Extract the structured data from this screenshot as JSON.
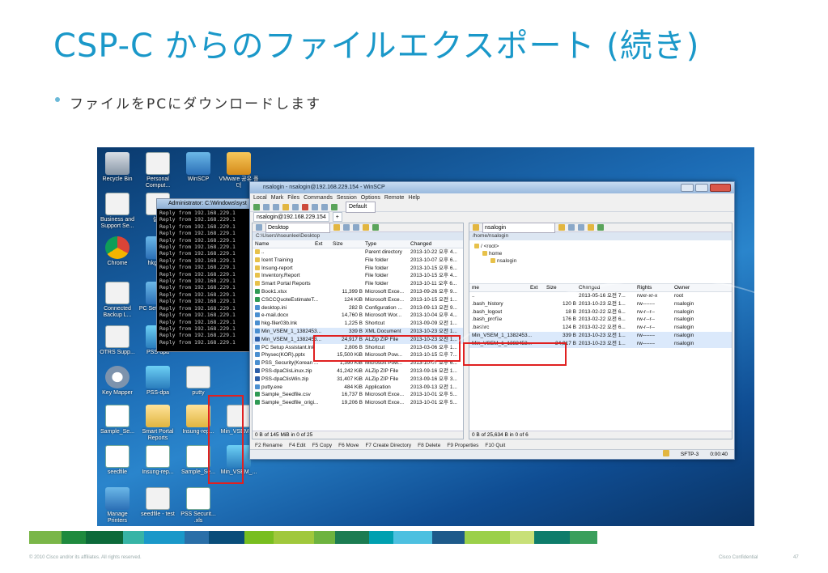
{
  "slide": {
    "title": "CSP-C からのファイルエクスポート (続き)",
    "bullet": "ファイルをPCにダウンロードします",
    "footer_copyright": "© 2010 Cisco and/or its affiliates. All rights reserved.",
    "footer_confidential": "Cisco Confidential",
    "page_number": "47"
  },
  "desktop_icons": [
    {
      "label": "Recycle Bin",
      "icon": "recycle-bin-icon"
    },
    {
      "label": "Personal Comput...",
      "icon": "document-icon"
    },
    {
      "label": "WinSCP",
      "icon": "winscp-icon"
    },
    {
      "label": "VMware 공유 폴더",
      "icon": "vmware-folder-icon"
    },
    {
      "label": "Business and Support Se...",
      "icon": "document-icon"
    },
    {
      "label": "설정",
      "icon": "document-icon"
    },
    {
      "label": "Chrome",
      "icon": "chrome-icon"
    },
    {
      "label": "hkg-filer",
      "icon": "network-icon"
    },
    {
      "label": "Connected Backup L...",
      "icon": "document-icon"
    },
    {
      "label": "PC Set Assista",
      "icon": "network-icon"
    },
    {
      "label": "OTRS Supp...",
      "icon": "document-icon"
    },
    {
      "label": "PSS-dpa",
      "icon": "zip-icon"
    },
    {
      "label": "Key Mapper",
      "icon": "gear-icon"
    },
    {
      "label": "PSS-dpa",
      "icon": "zip-icon"
    },
    {
      "label": "putty",
      "icon": "document-icon"
    },
    {
      "label": "Sample_Se...",
      "icon": "excel-icon"
    },
    {
      "label": "Smart Portal Reports",
      "icon": "folder-icon"
    },
    {
      "label": "Insung-rep...",
      "icon": "folder-icon"
    },
    {
      "label": "Min_VSEM_...",
      "icon": "xml-file-icon"
    },
    {
      "label": "seedfile",
      "icon": "excel-icon"
    },
    {
      "label": "Insung-rep...",
      "icon": "excel-icon"
    },
    {
      "label": "Sample_Se...",
      "icon": "excel-icon"
    },
    {
      "label": "Min_VSEM_...",
      "icon": "zip-icon"
    },
    {
      "label": "Manage Printers",
      "icon": "printer-icon"
    },
    {
      "label": "seedfile - test",
      "icon": "document-icon"
    },
    {
      "label": "PSS Securit... .xls",
      "icon": "excel-icon"
    }
  ],
  "cmd": {
    "title": "Administrator: C:\\Windows\\syst",
    "line": "Reply from 192.168.229.1"
  },
  "winscp": {
    "title": "nsalogin - nsalogin@192.168.229.154 - WinSCP",
    "menu": [
      "Local",
      "Mark",
      "Files",
      "Commands",
      "Session",
      "Options",
      "Remote",
      "Help"
    ],
    "transfer_setting": "Default",
    "session_tab": "nsalogin@192.168.229.154",
    "left": {
      "location": "Desktop",
      "path": "C:\\Users\\hseunlee\\Desktop",
      "columns": [
        "Name",
        "Ext",
        "Size",
        "Type",
        "Changed"
      ],
      "rows": [
        {
          "name": "..",
          "size": "",
          "type": "Parent directory",
          "changed": "2013-10-22 오후 4...",
          "icon": "up"
        },
        {
          "name": "Icent Training",
          "size": "",
          "type": "File folder",
          "changed": "2013-10-07 오후 6...",
          "icon": "folder"
        },
        {
          "name": "Insung-report",
          "size": "",
          "type": "File folder",
          "changed": "2013-10-15 오후 6...",
          "icon": "folder"
        },
        {
          "name": "Inventory.Report",
          "size": "",
          "type": "File folder",
          "changed": "2013-10-15 오후 4...",
          "icon": "folder"
        },
        {
          "name": "Smart Portal Reports",
          "size": "",
          "type": "File folder",
          "changed": "2013-10-11 오후 6...",
          "icon": "folder"
        },
        {
          "name": "Book1.xlsx",
          "size": "11,399 B",
          "type": "Microsoft Exce...",
          "changed": "2013-09-26 오후 9...",
          "icon": "xls"
        },
        {
          "name": "CSCCQuoteEstimateT...",
          "size": "124 KiB",
          "type": "Microsoft Exce...",
          "changed": "2013-10-15 오전 1...",
          "icon": "xls"
        },
        {
          "name": "desktop.ini",
          "size": "282 B",
          "type": "Configuration ...",
          "changed": "2013-09-13 오전 9...",
          "icon": "file"
        },
        {
          "name": "e-mail.docx",
          "size": "14,760 B",
          "type": "Microsoft Wor...",
          "changed": "2013-10-04 오후 4...",
          "icon": "file"
        },
        {
          "name": "hkg-filer03b.lnk",
          "size": "1,225 B",
          "type": "Shortcut",
          "changed": "2013-09-09 오전 1...",
          "icon": "file"
        },
        {
          "name": "Min_VSEM_1_1382453...",
          "size": "339 B",
          "type": "XML Document",
          "changed": "2013-10-23 오전 1...",
          "icon": "file"
        },
        {
          "name": "Min_VSEM_1_1382453...",
          "size": "24,917 B",
          "type": "ALZip ZIP File",
          "changed": "2013-10-23 오전 1...",
          "icon": "zip"
        },
        {
          "name": "PC Setup Assistant.lnk",
          "size": "2,806 B",
          "type": "Shortcut",
          "changed": "2013-03-06 오후 1...",
          "icon": "file"
        },
        {
          "name": "Physec(KOR).pptx",
          "size": "15,500 KiB",
          "type": "Microsoft Pow...",
          "changed": "2013-10-15 오후 7...",
          "icon": "file"
        },
        {
          "name": "PSS_Security(Korean ...",
          "size": "1,390 KiB",
          "type": "Microsoft Pow...",
          "changed": "2013-10-07 오후 6...",
          "icon": "file"
        },
        {
          "name": "PSS-dpaClisLinux.zip",
          "size": "41,242 KiB",
          "type": "ALZip ZIP File",
          "changed": "2013-09-16 오전 1...",
          "icon": "zip"
        },
        {
          "name": "PSS-dpaClisWin.zip",
          "size": "31,407 KiB",
          "type": "ALZip ZIP File",
          "changed": "2013-09-16 오후 3...",
          "icon": "zip"
        },
        {
          "name": "putty.exe",
          "size": "484 KiB",
          "type": "Application",
          "changed": "2013-09-13 오전 1...",
          "icon": "file"
        },
        {
          "name": "Sample_Seedfile.csv",
          "size": "16,737 B",
          "type": "Microsoft Exce...",
          "changed": "2013-10-01 오후 5...",
          "icon": "xls"
        },
        {
          "name": "Sample_Seedfile_origi...",
          "size": "19,206 B",
          "type": "Microsoft Exce...",
          "changed": "2013-10-01 오후 5...",
          "icon": "xls"
        }
      ],
      "status": "0 B of 145 MiB in 0 of 25"
    },
    "right": {
      "location": "nsalogin",
      "path": "/home/nsalogin",
      "tree": [
        "/ <root>",
        "home",
        "nsalogin"
      ],
      "columns": [
        "me",
        "Ext",
        "Size",
        "Changed",
        "Rights",
        "Owner"
      ],
      "rows": [
        {
          "name": "..",
          "size": "",
          "changed": "2013-05-16 오전 7...",
          "rights": "rwxr-xr-x",
          "owner": "root"
        },
        {
          "name": ".bash_history",
          "size": "120 B",
          "changed": "2013-10-23 오전 1...",
          "rights": "rw-------",
          "owner": "nsalogin"
        },
        {
          "name": ".bash_logout",
          "size": "18 B",
          "changed": "2013-02-22 오전 6...",
          "rights": "rw-r--r--",
          "owner": "nsalogin"
        },
        {
          "name": ".bash_profile",
          "size": "176 B",
          "changed": "2013-02-22 오전 6...",
          "rights": "rw-r--r--",
          "owner": "nsalogin"
        },
        {
          "name": ".bashrc",
          "size": "124 B",
          "changed": "2013-02-22 오전 6...",
          "rights": "rw-r--r--",
          "owner": "nsalogin"
        },
        {
          "name": "Min_VSEM_1_1382453...",
          "size": "339 B",
          "changed": "2013-10-23 오전 1...",
          "rights": "rw-------",
          "owner": "nsalogin"
        },
        {
          "name": "Min_VSEM_1_1382453...",
          "size": "24,917 B",
          "changed": "2013-10-23 오전 1...",
          "rights": "rw-------",
          "owner": "nsalogin"
        }
      ],
      "status": "0 B of 25,634 B in 0 of 6"
    },
    "fkeys": [
      "F2 Rename",
      "F4 Edit",
      "F5 Copy",
      "F6 Move",
      "F7 Create Directory",
      "F8 Delete",
      "F9 Properties",
      "F10 Quit"
    ],
    "status_protocol": "SFTP-3",
    "status_time": "0:00:40"
  },
  "band_colors": [
    "#7ab648",
    "#1f8a3e",
    "#0d6a3a",
    "#37b4a6",
    "#1a98c9",
    "#2a6fa8",
    "#0a4d7a",
    "#78be20",
    "#a0c83c",
    "#6db33f",
    "#1c7c52",
    "#00a0b0",
    "#4dc0e0",
    "#1e5a8a",
    "#9bd04a",
    "#c8e078",
    "#0e7c6b",
    "#3a9f5c"
  ]
}
